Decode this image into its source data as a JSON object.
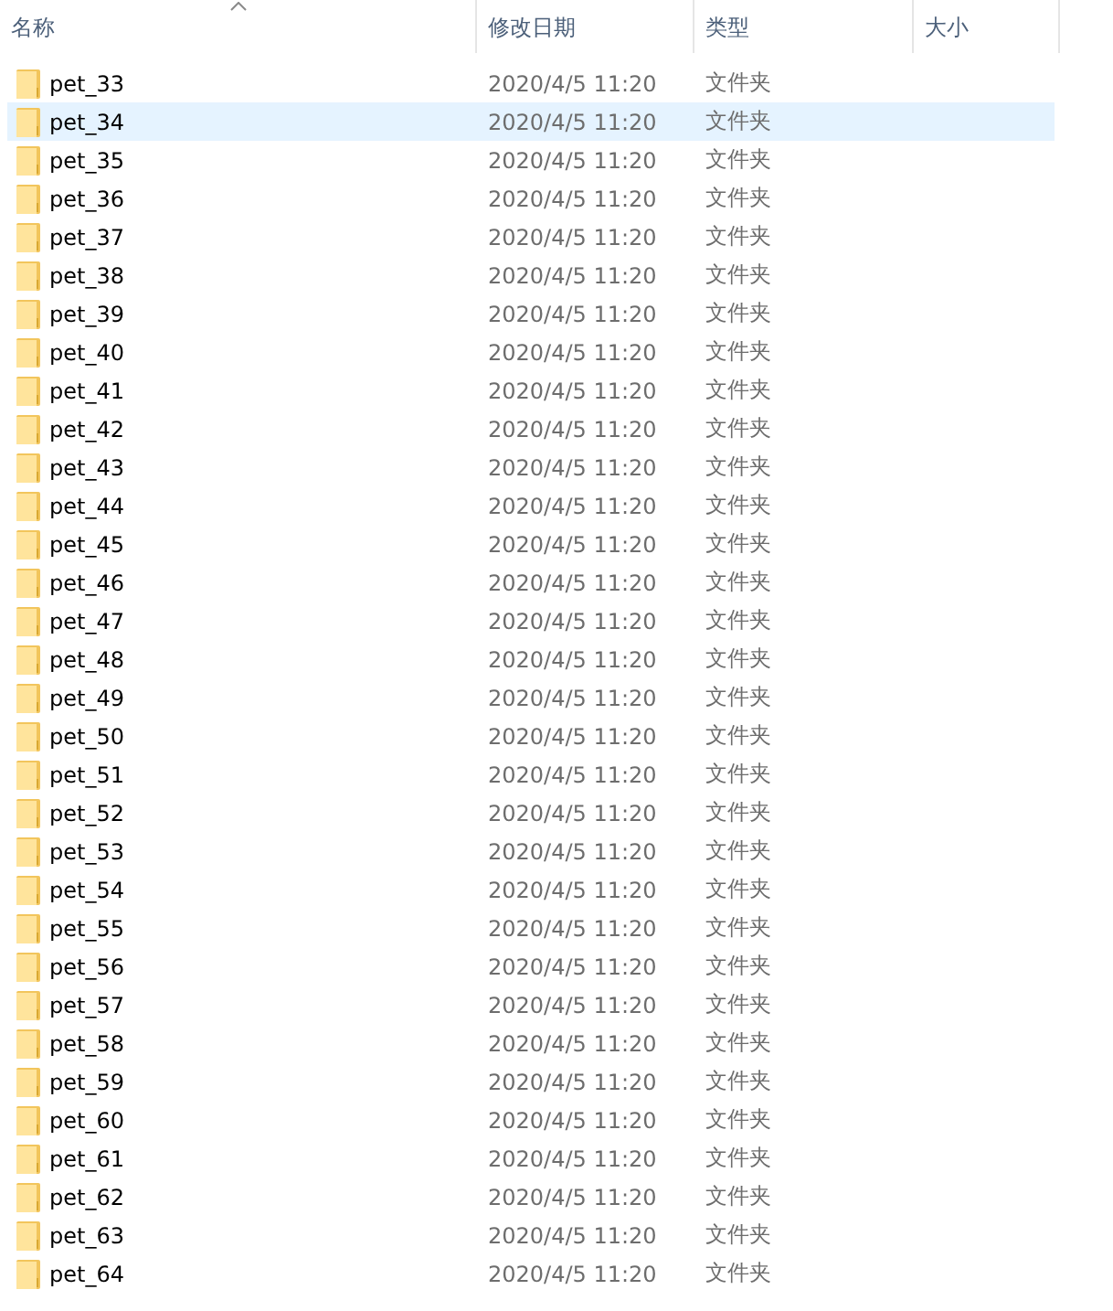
{
  "columns": [
    {
      "label": "名称",
      "sorted": true
    },
    {
      "label": "修改日期",
      "sorted": false
    },
    {
      "label": "类型",
      "sorted": false
    },
    {
      "label": "大小",
      "sorted": false
    }
  ],
  "rows": [
    {
      "name": "pet_33",
      "modified": "2020/4/5 11:20",
      "type": "文件夹",
      "selected": false
    },
    {
      "name": "pet_34",
      "modified": "2020/4/5 11:20",
      "type": "文件夹",
      "selected": true
    },
    {
      "name": "pet_35",
      "modified": "2020/4/5 11:20",
      "type": "文件夹",
      "selected": false
    },
    {
      "name": "pet_36",
      "modified": "2020/4/5 11:20",
      "type": "文件夹",
      "selected": false
    },
    {
      "name": "pet_37",
      "modified": "2020/4/5 11:20",
      "type": "文件夹",
      "selected": false
    },
    {
      "name": "pet_38",
      "modified": "2020/4/5 11:20",
      "type": "文件夹",
      "selected": false
    },
    {
      "name": "pet_39",
      "modified": "2020/4/5 11:20",
      "type": "文件夹",
      "selected": false
    },
    {
      "name": "pet_40",
      "modified": "2020/4/5 11:20",
      "type": "文件夹",
      "selected": false
    },
    {
      "name": "pet_41",
      "modified": "2020/4/5 11:20",
      "type": "文件夹",
      "selected": false
    },
    {
      "name": "pet_42",
      "modified": "2020/4/5 11:20",
      "type": "文件夹",
      "selected": false
    },
    {
      "name": "pet_43",
      "modified": "2020/4/5 11:20",
      "type": "文件夹",
      "selected": false
    },
    {
      "name": "pet_44",
      "modified": "2020/4/5 11:20",
      "type": "文件夹",
      "selected": false
    },
    {
      "name": "pet_45",
      "modified": "2020/4/5 11:20",
      "type": "文件夹",
      "selected": false
    },
    {
      "name": "pet_46",
      "modified": "2020/4/5 11:20",
      "type": "文件夹",
      "selected": false
    },
    {
      "name": "pet_47",
      "modified": "2020/4/5 11:20",
      "type": "文件夹",
      "selected": false
    },
    {
      "name": "pet_48",
      "modified": "2020/4/5 11:20",
      "type": "文件夹",
      "selected": false
    },
    {
      "name": "pet_49",
      "modified": "2020/4/5 11:20",
      "type": "文件夹",
      "selected": false
    },
    {
      "name": "pet_50",
      "modified": "2020/4/5 11:20",
      "type": "文件夹",
      "selected": false
    },
    {
      "name": "pet_51",
      "modified": "2020/4/5 11:20",
      "type": "文件夹",
      "selected": false
    },
    {
      "name": "pet_52",
      "modified": "2020/4/5 11:20",
      "type": "文件夹",
      "selected": false
    },
    {
      "name": "pet_53",
      "modified": "2020/4/5 11:20",
      "type": "文件夹",
      "selected": false
    },
    {
      "name": "pet_54",
      "modified": "2020/4/5 11:20",
      "type": "文件夹",
      "selected": false
    },
    {
      "name": "pet_55",
      "modified": "2020/4/5 11:20",
      "type": "文件夹",
      "selected": false
    },
    {
      "name": "pet_56",
      "modified": "2020/4/5 11:20",
      "type": "文件夹",
      "selected": false
    },
    {
      "name": "pet_57",
      "modified": "2020/4/5 11:20",
      "type": "文件夹",
      "selected": false
    },
    {
      "name": "pet_58",
      "modified": "2020/4/5 11:20",
      "type": "文件夹",
      "selected": false
    },
    {
      "name": "pet_59",
      "modified": "2020/4/5 11:20",
      "type": "文件夹",
      "selected": false
    },
    {
      "name": "pet_60",
      "modified": "2020/4/5 11:20",
      "type": "文件夹",
      "selected": false
    },
    {
      "name": "pet_61",
      "modified": "2020/4/5 11:20",
      "type": "文件夹",
      "selected": false
    },
    {
      "name": "pet_62",
      "modified": "2020/4/5 11:20",
      "type": "文件夹",
      "selected": false
    },
    {
      "name": "pet_63",
      "modified": "2020/4/5 11:20",
      "type": "文件夹",
      "selected": false
    },
    {
      "name": "pet_64",
      "modified": "2020/4/5 11:20",
      "type": "文件夹",
      "selected": false
    }
  ]
}
